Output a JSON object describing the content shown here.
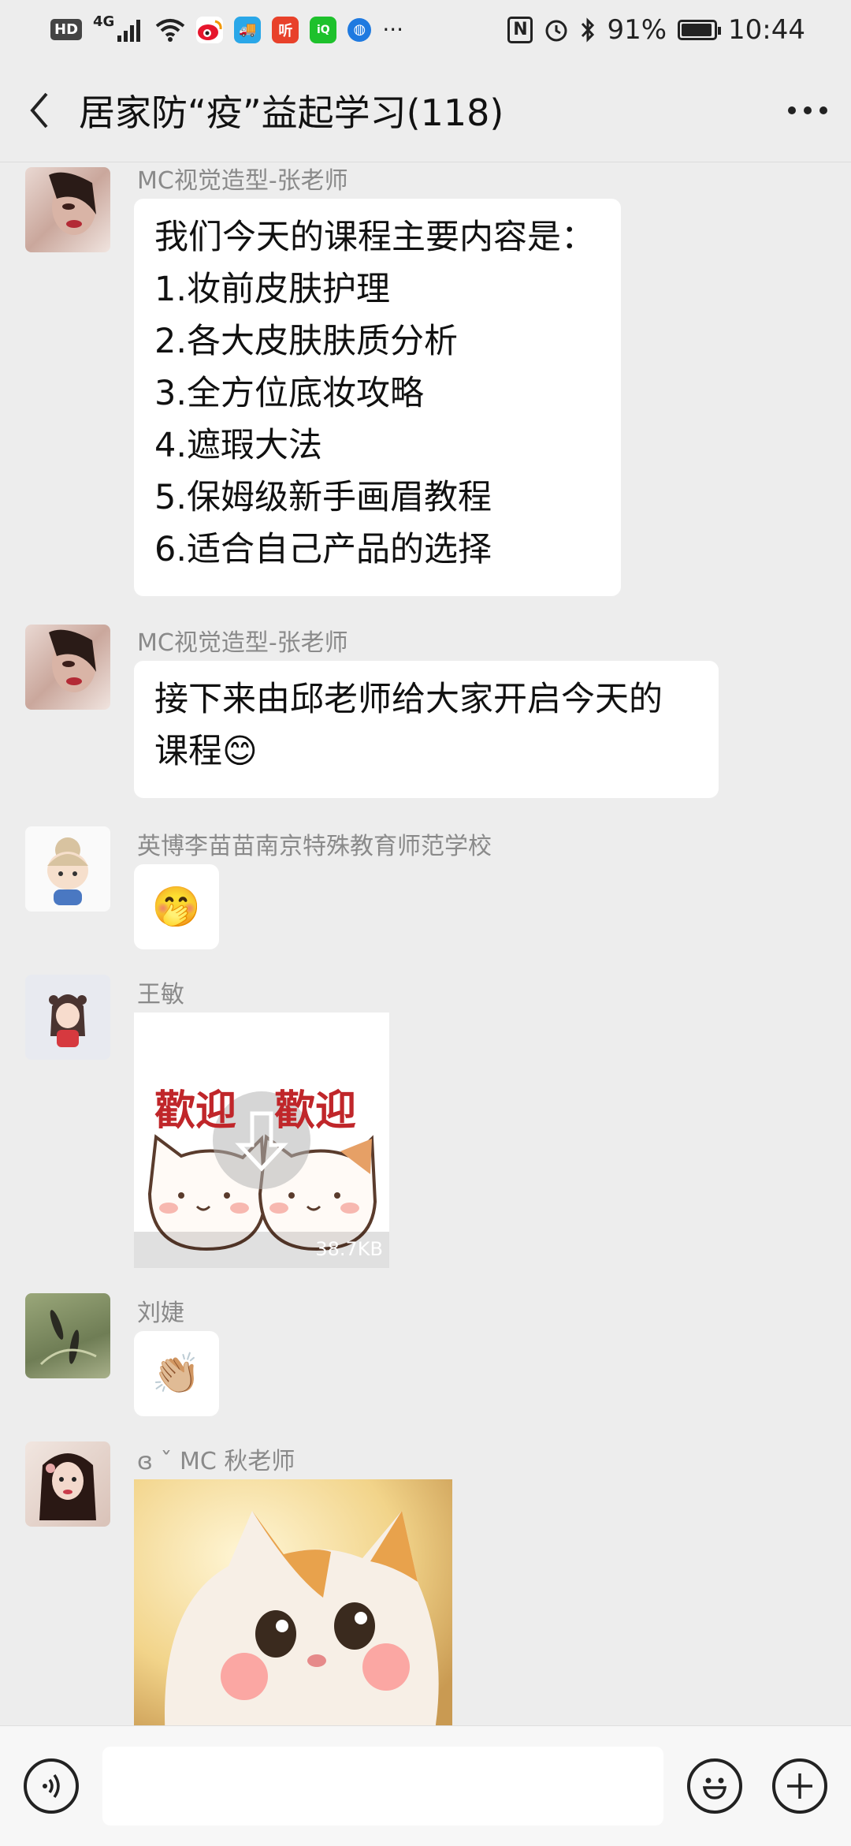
{
  "status_bar": {
    "hd": "HD",
    "network": "4G",
    "more": "···",
    "battery": "91%",
    "time": "10:44",
    "app_icons": [
      "weibo-icon",
      "car-app-icon",
      "ting-app-icon",
      "iqiyi-icon",
      "browser-icon"
    ]
  },
  "header": {
    "back": "‹",
    "title": "居家防“疫”益起学习(118)",
    "more": "···"
  },
  "messages": [
    {
      "sender": "MC视觉造型-张老师",
      "lines": [
        "我们今天的课程主要内容是：",
        "1.妆前皮肤护理",
        "2.各大皮肤肤质分析",
        "3.全方位底妆攻略",
        "4.遮瑕大法",
        "5.保姆级新手画眉教程",
        "6.适合自己产品的选择"
      ]
    },
    {
      "sender": "MC视觉造型-张老师",
      "lines": [
        "接下来由邱老师给大家开启今天的",
        "课程😊"
      ]
    },
    {
      "sender": "英博李苗苗南京特殊教育师范学校",
      "emoji": "🤭"
    },
    {
      "sender": "王敏",
      "image": {
        "caption_left": "歡迎",
        "caption_right": "歡迎",
        "size": "38.7KB"
      }
    },
    {
      "sender": "刘婕",
      "emoji": "👏🏼"
    },
    {
      "sender": "ɞ ˇ MC 秋老师"
    }
  ],
  "input_bar": {
    "voice_icon": "voice-icon",
    "emoji_icon": "emoji-icon",
    "plus_icon": "plus-icon",
    "placeholder": ""
  }
}
